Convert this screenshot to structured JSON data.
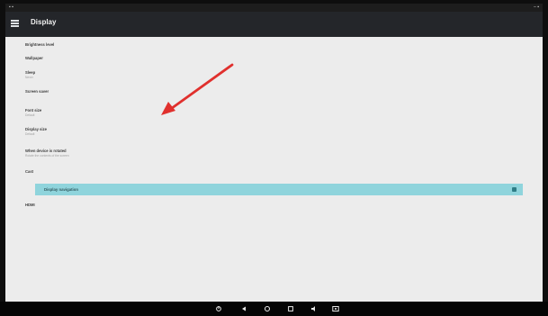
{
  "statusbar": {
    "left": "▪ ▪",
    "right": "– ▪"
  },
  "appbar": {
    "title": "Display",
    "menu_icon": "menu-icon"
  },
  "settings": [
    {
      "title": "Brightness level",
      "summary": ""
    },
    {
      "title": "Wallpaper",
      "summary": ""
    },
    {
      "title": "Sleep",
      "summary": "Never"
    },
    {
      "title": "Screen saver",
      "summary": ""
    },
    {
      "title": "Font size",
      "summary": "Default"
    },
    {
      "title": "Display size",
      "summary": "Default"
    },
    {
      "title": "When device is rotated",
      "summary": "Rotate the contents of the screen"
    },
    {
      "title": "Cast",
      "summary": ""
    },
    {
      "title": "Display navigation",
      "summary": ""
    },
    {
      "title": "HDMI",
      "summary": ""
    }
  ],
  "highlighted_index": 8,
  "navbar": {
    "icons": [
      "power-icon",
      "back-icon",
      "home-icon",
      "recent-apps-icon",
      "audio-icon",
      "screenshot-icon"
    ]
  },
  "colors": {
    "highlight": "#8fd4dc",
    "arrow": "#e0302d",
    "background": "#ececec"
  }
}
